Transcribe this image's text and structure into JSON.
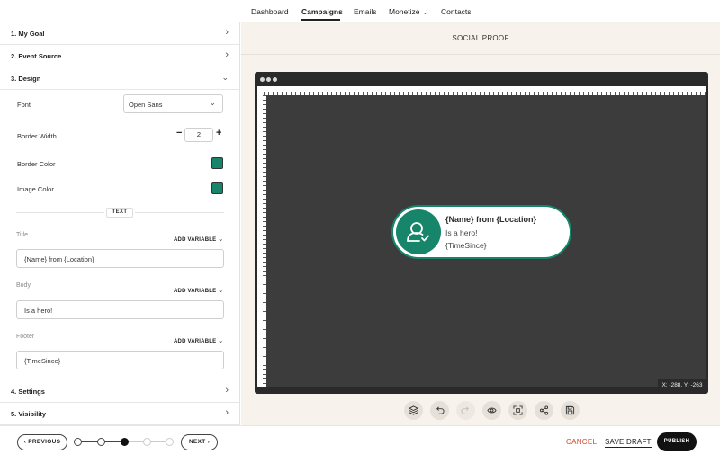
{
  "topnav": {
    "items": [
      {
        "label": "Dashboard"
      },
      {
        "label": "Campaigns"
      },
      {
        "label": "Emails"
      },
      {
        "label": "Monetize"
      },
      {
        "label": "Contacts"
      }
    ],
    "active": "Campaigns"
  },
  "sections": {
    "goal": "1. My Goal",
    "event_source": "2. Event Source",
    "design": "3. Design",
    "settings": "4. Settings",
    "visibility": "5. Visibility"
  },
  "design": {
    "font_label": "Font",
    "font_value": "Open Sans",
    "border_width_label": "Border Width",
    "border_width_value": "2",
    "border_color_label": "Border Color",
    "border_color": "#16856a",
    "image_color_label": "Image Color",
    "image_color": "#16856a",
    "text_divider": "TEXT",
    "add_variable": "ADD VARIABLE",
    "title_label": "Title",
    "title_value": "{Name} from {Location}",
    "body_label": "Body",
    "body_value": "Is a hero!",
    "footer_label": "Footer",
    "footer_value": "{TimeSince}"
  },
  "preview": {
    "heading": "SOCIAL PROOF",
    "coordinates": "X: -288, Y: -263",
    "notification": {
      "title": "{Name} from {Location}",
      "body": "Is a hero!",
      "footer": "{TimeSince}"
    },
    "tools": [
      "layers-icon",
      "undo-icon",
      "redo-icon",
      "preview-eye-icon",
      "fit-screen-icon",
      "share-icon",
      "save-icon"
    ]
  },
  "footer": {
    "previous": "PREVIOUS",
    "next": "NEXT",
    "cancel": "CANCEL",
    "save_draft": "SAVE DRAFT",
    "publish": "PUBLISH",
    "current_step": 3,
    "total_steps": 5
  },
  "colors": {
    "accent": "#16856a",
    "cancel": "#d3432e",
    "canvas": "#3c3c3c",
    "panel_bg": "#f7f3ec"
  }
}
